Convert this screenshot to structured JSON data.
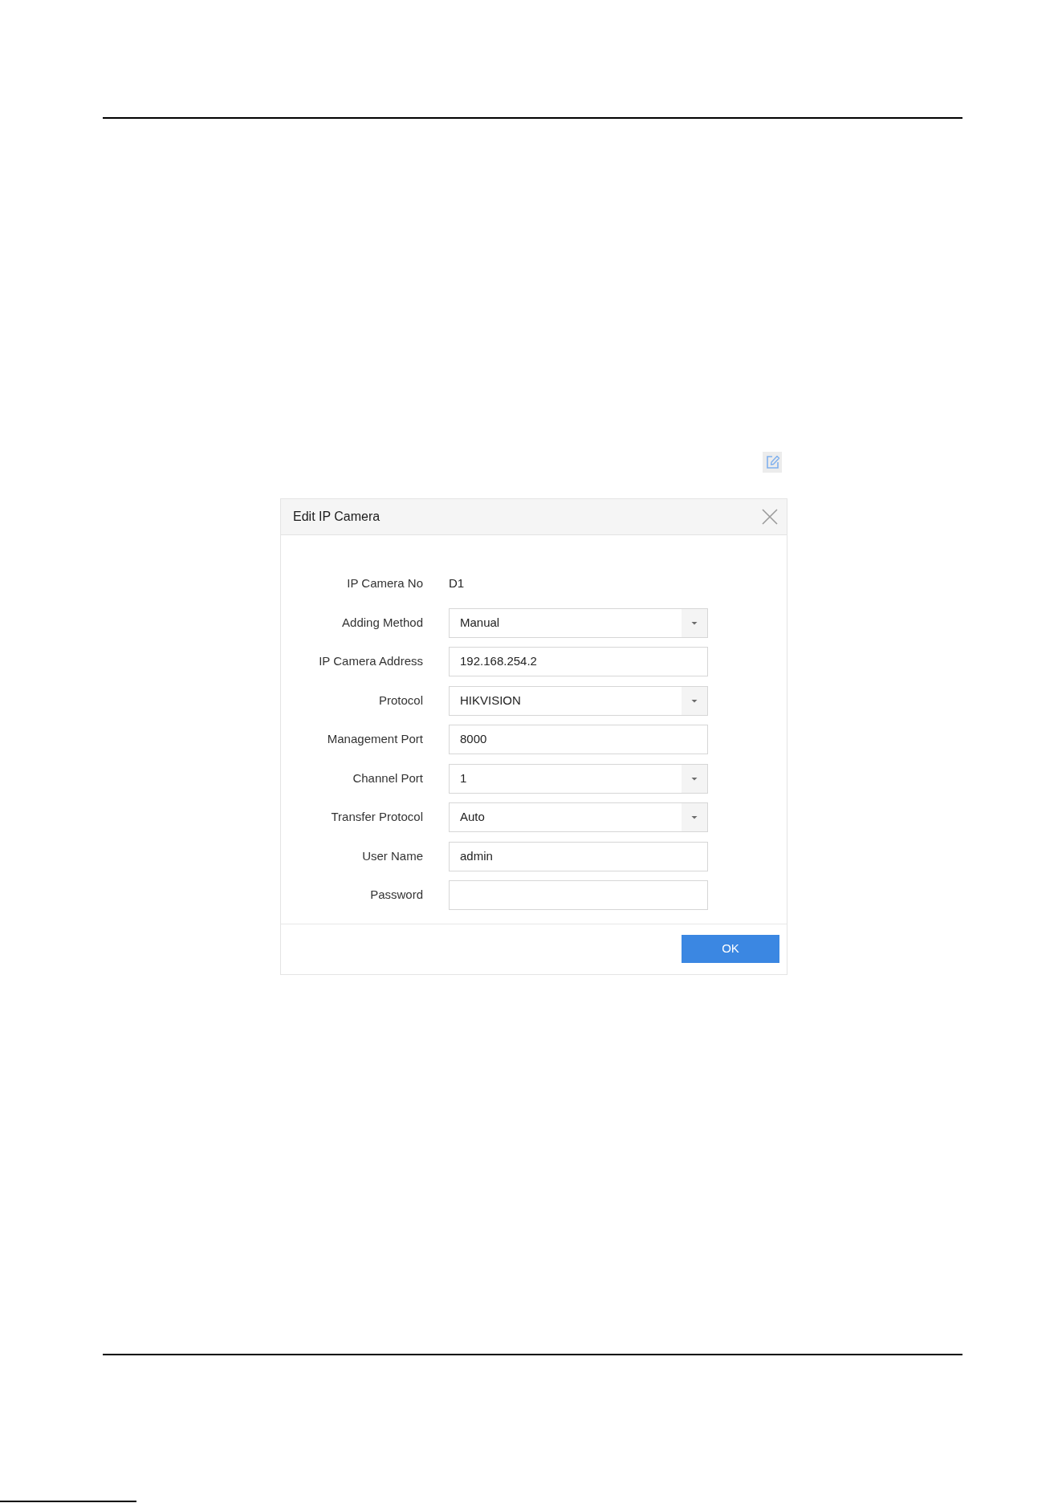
{
  "dialog": {
    "title": "Edit IP Camera",
    "fields": [
      {
        "kind": "text",
        "label": "IP Camera No",
        "value": "D1"
      },
      {
        "kind": "dropdown",
        "label": "Adding Method",
        "value": "Manual"
      },
      {
        "kind": "input",
        "label": "IP Camera Address",
        "value": "192.168.254.2"
      },
      {
        "kind": "dropdown",
        "label": "Protocol",
        "value": "HIKVISION"
      },
      {
        "kind": "input",
        "label": "Management Port",
        "value": "8000"
      },
      {
        "kind": "dropdown",
        "label": "Channel Port",
        "value": "1"
      },
      {
        "kind": "dropdown",
        "label": "Transfer Protocol",
        "value": "Auto"
      },
      {
        "kind": "input",
        "label": "User Name",
        "value": "admin"
      },
      {
        "kind": "input",
        "label": "Password"
      }
    ],
    "buttons": [
      "OK"
    ]
  }
}
